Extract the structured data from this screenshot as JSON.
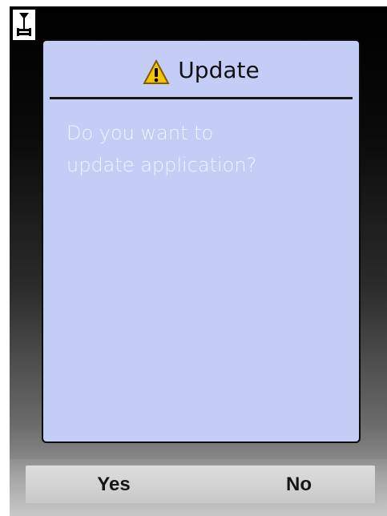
{
  "status": {
    "icon": "signal-antenna-icon"
  },
  "dialog": {
    "icon": "warning-icon",
    "title": "Update",
    "message_lines": [
      "Do you want to",
      "update application?"
    ]
  },
  "softkeys": {
    "left_label": "Yes",
    "right_label": "No"
  },
  "colors": {
    "dialog_background": "#c4cdf6",
    "dialog_text": "#f1f4ff",
    "warning_yellow": "#f5c400"
  }
}
